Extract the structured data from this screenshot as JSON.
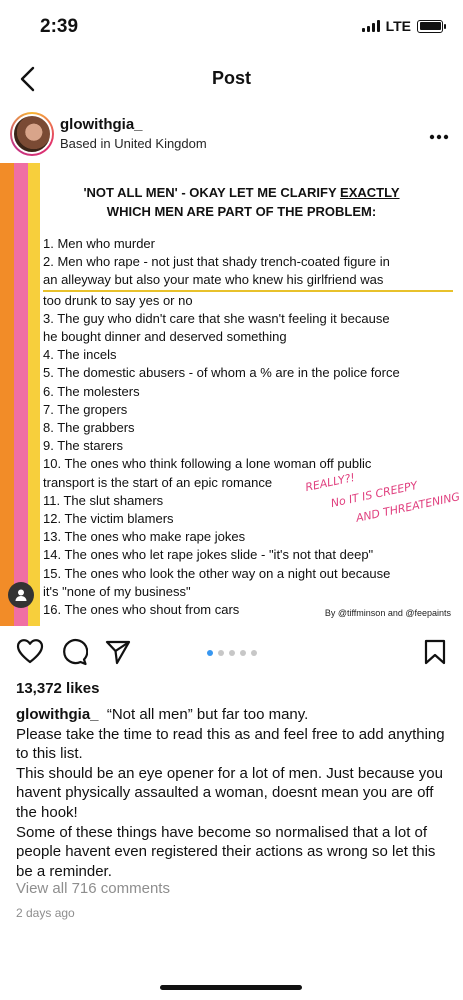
{
  "status": {
    "time": "2:39",
    "network": "LTE"
  },
  "nav": {
    "title": "Post"
  },
  "author": {
    "username": "glowithgia_",
    "location": "Based in United Kingdom"
  },
  "image": {
    "title_line1": "'NOT ALL MEN' - OKAY LET ME CLARIFY",
    "title_emph": "EXACTLY",
    "title_line2": "WHICH MEN ARE PART OF THE PROBLEM:",
    "list": [
      "1. Men who murder",
      "2. Men who rape - not just that shady trench-coated figure in",
      "an alleyway but also your mate who knew his girlfriend was",
      "too drunk to say yes or no",
      "3. The guy who didn't care that she wasn't feeling it because",
      "he bought dinner and deserved something",
      "4. The incels",
      "5. The domestic abusers - of whom a % are in the police force",
      "6. The molesters",
      "7. The gropers",
      "8. The grabbers",
      "9. The starers",
      "10. The ones who think following a lone woman off public",
      "transport is the start of an epic romance",
      "11. The slut shamers",
      "12. The victim blamers",
      "13. The ones who make rape jokes",
      "14. The ones who let rape jokes slide - \"it's not that deep\"",
      "15. The ones who look the other way on a night out because",
      "it's \"none of my business\"",
      "16. The ones who shout from cars"
    ],
    "handwriting": [
      "REALLY?!",
      "No IT IS CREEPY",
      "AND THREATENING"
    ],
    "credit": "By @tiffminson and @feepaints"
  },
  "carousel": {
    "total": 5,
    "active": 0
  },
  "likes": "13,372 likes",
  "caption": {
    "user": "glowithgia_",
    "paragraphs": [
      "“Not all men” but far too many.",
      "Please take the time to read this as and feel free to add anything to this list.",
      "This should be an eye opener for a lot of men. Just because you havent physically assaulted a woman, doesnt mean you are off the hook!",
      "Some of these things have become so normalised that a lot of people havent even registered their actions as wrong so let this be a reminder."
    ]
  },
  "comments_link": "View all 716 comments",
  "time_ago": "2 days ago",
  "icons": {
    "back": "chevron-left-icon",
    "more": "more-horizontal-icon",
    "like": "heart-icon",
    "comment": "comment-icon",
    "share": "send-icon",
    "save": "bookmark-icon"
  },
  "colors": {
    "stripe_orange": "#f28c28",
    "stripe_pink": "#f06fa3",
    "stripe_yellow": "#f7cf3c",
    "active_dot": "#3897f0",
    "muted": "#8e8e8e"
  }
}
